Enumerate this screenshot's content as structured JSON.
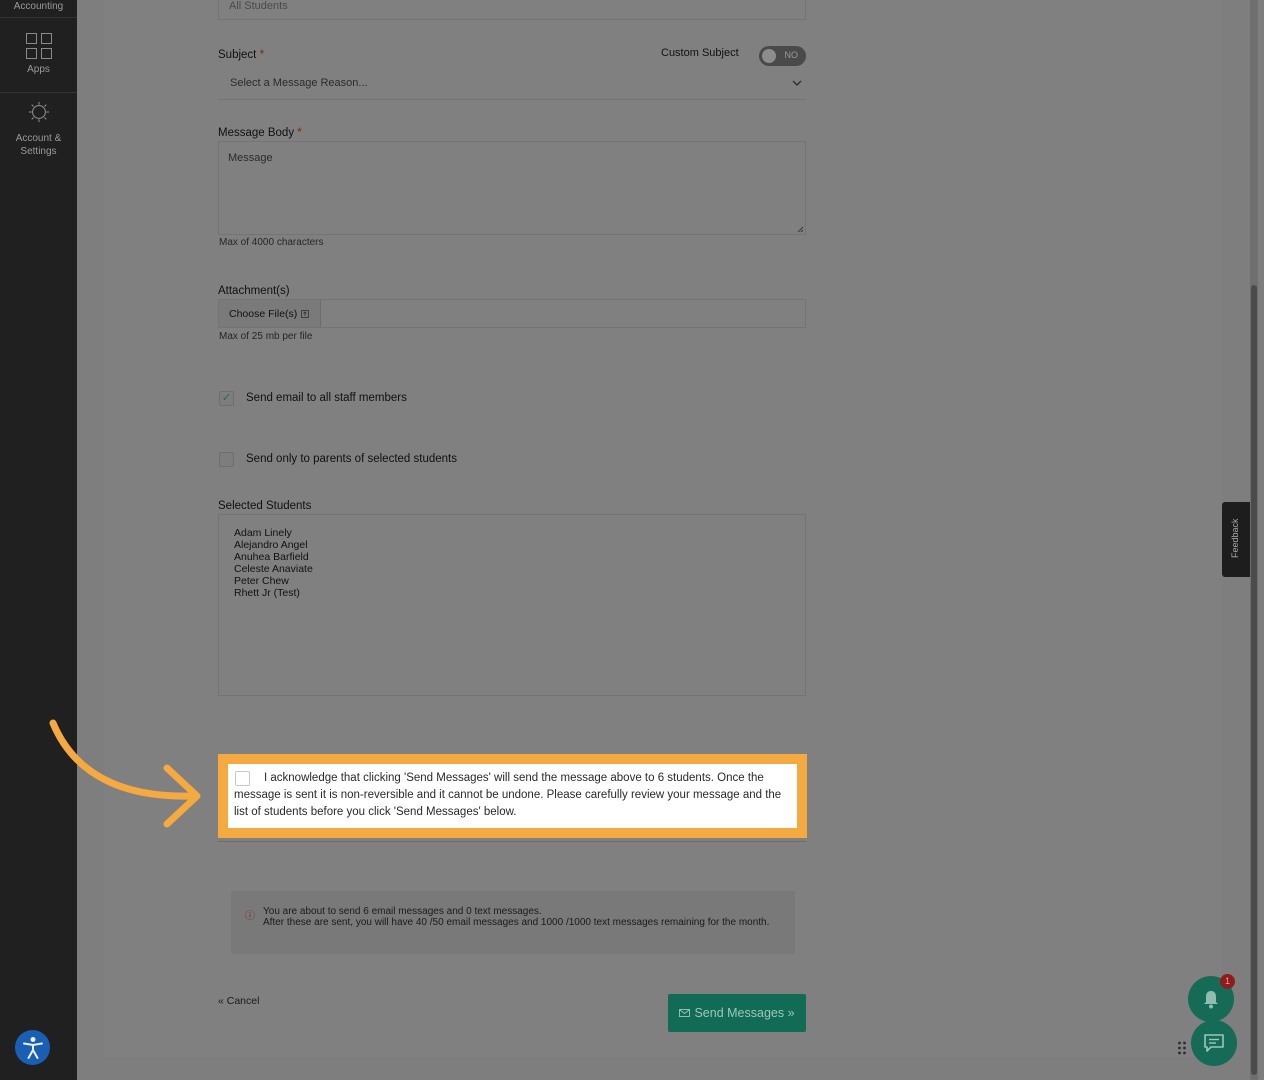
{
  "sidebar": {
    "top_label": "Accounting",
    "apps_label": "Apps",
    "account_label_line1": "Account &",
    "account_label_line2": "Settings"
  },
  "form": {
    "recipient_value": "All Students",
    "subject_label": "Subject",
    "custom_subject_label": "Custom Subject",
    "custom_subject_toggle": "NO",
    "subject_select_value": "Select a Message Reason...",
    "message_body_label": "Message Body",
    "message_placeholder": "Message",
    "max_chars_note": "Max of 4000 characters",
    "attachments_label": "Attachment(s)",
    "choose_files_label": "Choose File(s)",
    "max_file_note": "Max of 25 mb per file",
    "send_staff_label": "Send email to all staff members",
    "send_staff_checked": true,
    "send_parents_label": "Send only to parents of selected students",
    "send_parents_checked": false,
    "selected_students_label": "Selected Students",
    "selected_students": [
      "Adam Linely",
      "Alejandro Angel",
      "Anuhea Barfield",
      "Celeste Anaviate",
      "Peter Chew",
      "Rhett Jr (Test)"
    ],
    "acknowledge_text": "I acknowledge that clicking 'Send Messages' will send the message above to 6 students. Once the message is sent it is non-reversible and it cannot be undone. Please carefully review your message and the list of students before you click 'Send Messages' below.",
    "info_line1": "You are about to send 6 email messages and 0 text messages.",
    "info_line2": "After these are sent, you will have 40 /50 email messages and 1000 /1000 text messages remaining for the month.",
    "cancel_label": "« Cancel",
    "send_label": "Send Messages »"
  },
  "feedback_label": "Feedback",
  "notification_count": "1",
  "colors": {
    "highlight": "#f5a941",
    "primary_button": "#126b54",
    "sidebar": "#202020",
    "required": "#8b1b1b"
  }
}
